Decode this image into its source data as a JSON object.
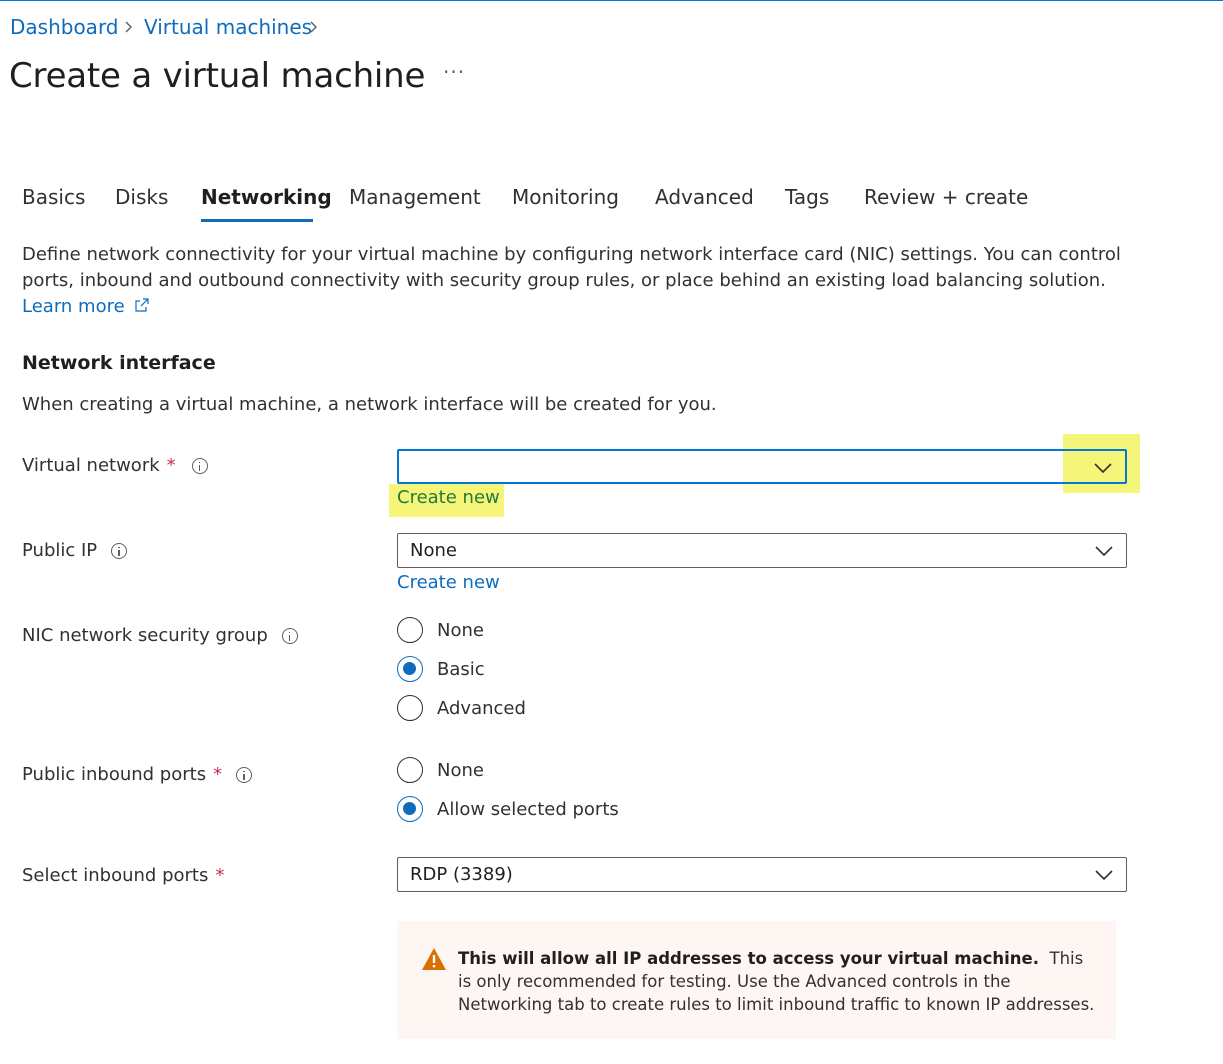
{
  "breadcrumb": {
    "dashboard": "Dashboard",
    "virtual_machines": "Virtual machines"
  },
  "page": {
    "title": "Create a virtual machine",
    "more": "···"
  },
  "tabs": [
    "Basics",
    "Disks",
    "Networking",
    "Management",
    "Monitoring",
    "Advanced",
    "Tags",
    "Review + create"
  ],
  "active_tab": "Networking",
  "intro": {
    "text": "Define network connectivity for your virtual machine by configuring network interface card (NIC) settings. You can control ports, inbound and outbound connectivity with security group rules, or place behind an existing load balancing solution.",
    "learn_more": "Learn more"
  },
  "network_interface": {
    "heading": "Network interface",
    "description": "When creating a virtual machine, a network interface will be created for you."
  },
  "virtual_network": {
    "label": "Virtual network",
    "required": "*",
    "value": "",
    "create_new": "Create new"
  },
  "public_ip": {
    "label": "Public IP",
    "value": "None",
    "create_new": "Create new"
  },
  "nic_nsg": {
    "label": "NIC network security group",
    "options": [
      "None",
      "Basic",
      "Advanced"
    ],
    "selected": "Basic"
  },
  "public_inbound_ports": {
    "label": "Public inbound ports",
    "required": "*",
    "options": [
      "None",
      "Allow selected ports"
    ],
    "selected": "Allow selected ports"
  },
  "select_inbound_ports": {
    "label": "Select inbound ports",
    "required": "*",
    "value": "RDP (3389)"
  },
  "warning": {
    "bold": "This will allow all IP addresses to access your virtual machine.",
    "text": "This is only recommended for testing.  Use the Advanced controls in the Networking tab to create rules to limit inbound traffic to known IP addresses."
  },
  "colors": {
    "accent": "#0f6cbd",
    "required": "#c4314b",
    "highlight": "#f3f46a",
    "warning_bg": "#fdf6f3",
    "warning_icon": "#d86f00"
  }
}
